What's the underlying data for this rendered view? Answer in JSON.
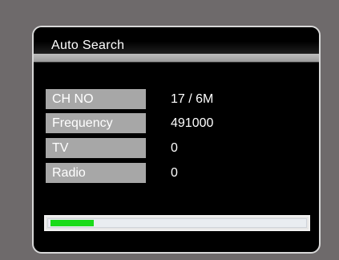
{
  "dialog": {
    "title": "Auto Search",
    "fields": [
      {
        "label": "CH NO",
        "value": "17 / 6M"
      },
      {
        "label": "Frequency",
        "value": "491000"
      },
      {
        "label": "TV",
        "value": "0"
      },
      {
        "label": "Radio",
        "value": "0"
      }
    ],
    "progress": {
      "fraction": 0.17,
      "fill_color": "#1adb1a"
    }
  }
}
